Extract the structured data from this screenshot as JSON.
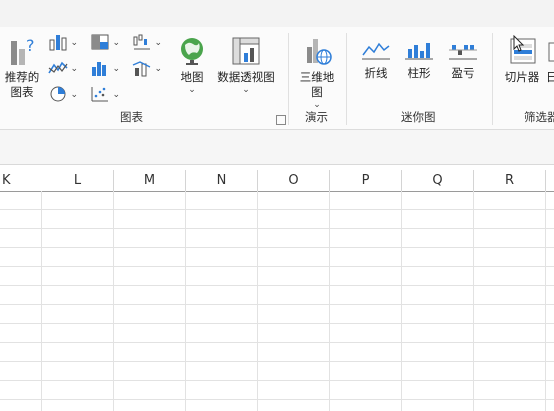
{
  "ribbon": {
    "recommended_charts": {
      "line1": "推荐的",
      "line2": "图表"
    },
    "maps": {
      "label": "地图"
    },
    "pivot_chart": {
      "label": "数据透视图"
    },
    "charts_group": "图表",
    "map_3d": {
      "line1": "三维地",
      "line2": "图"
    },
    "tours_group": "演示",
    "spark_line": "折线",
    "spark_column": "柱形",
    "spark_winloss": "盈亏",
    "sparklines_group": "迷你图",
    "slicer": "切片器",
    "timeline_partial": "日",
    "filters_group": "筛选器"
  },
  "columns": [
    "K",
    "L",
    "M",
    "N",
    "O",
    "P",
    "Q",
    "R"
  ],
  "colors": {
    "accent_blue": "#2f7ed8",
    "ribbon_bg": "#fbfbfb",
    "grid": "#e4e4e4"
  }
}
